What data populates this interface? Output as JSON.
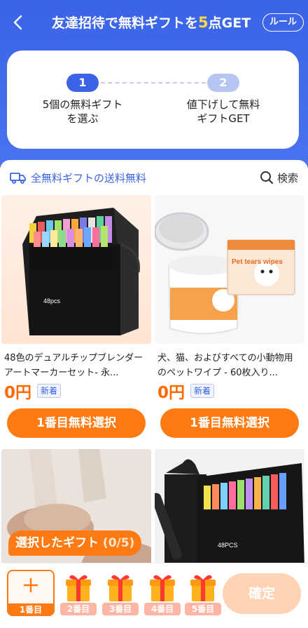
{
  "header": {
    "title_prefix": "友達招待で無料ギフトを",
    "title_highlight": "5",
    "title_suffix": "点GET",
    "rule_label": "ルール"
  },
  "steps": [
    {
      "num": "1",
      "label_line1": "5個の無料ギフト",
      "label_line2": "を選ぶ"
    },
    {
      "num": "2",
      "label_line1": "値下げして無料",
      "label_line2": "ギフトGET"
    }
  ],
  "shipping_label": "全無料ギフトの送料無料",
  "search_label": "検索",
  "products": [
    {
      "name": "48色のデュアルチップブレンダーアートマーカーセット- 永...",
      "price": "0円",
      "badge": "新着",
      "button": "1番目無料選択",
      "image_text": "48pcs"
    },
    {
      "name": "犬、猫、およびすべての小動物用のペットワイプ - 60枚入り...",
      "price": "0円",
      "badge": "新着",
      "button": "1番目無料選択",
      "image_text": "Pet tears wipes"
    }
  ],
  "product_images_row2": [
    {
      "image_text": ""
    },
    {
      "image_text": "48PCS"
    }
  ],
  "selected_tip": "選択したギフト",
  "selected_count": "(0/5)",
  "slots": [
    "1番目",
    "2番目",
    "3番目",
    "4番目",
    "5番目"
  ],
  "confirm_label": "確定",
  "colors": {
    "brand_blue": "#3a63e6",
    "accent_orange": "#ff7a12",
    "price_orange": "#ff6a00",
    "confirm_disabled": "#ffd3b3"
  }
}
